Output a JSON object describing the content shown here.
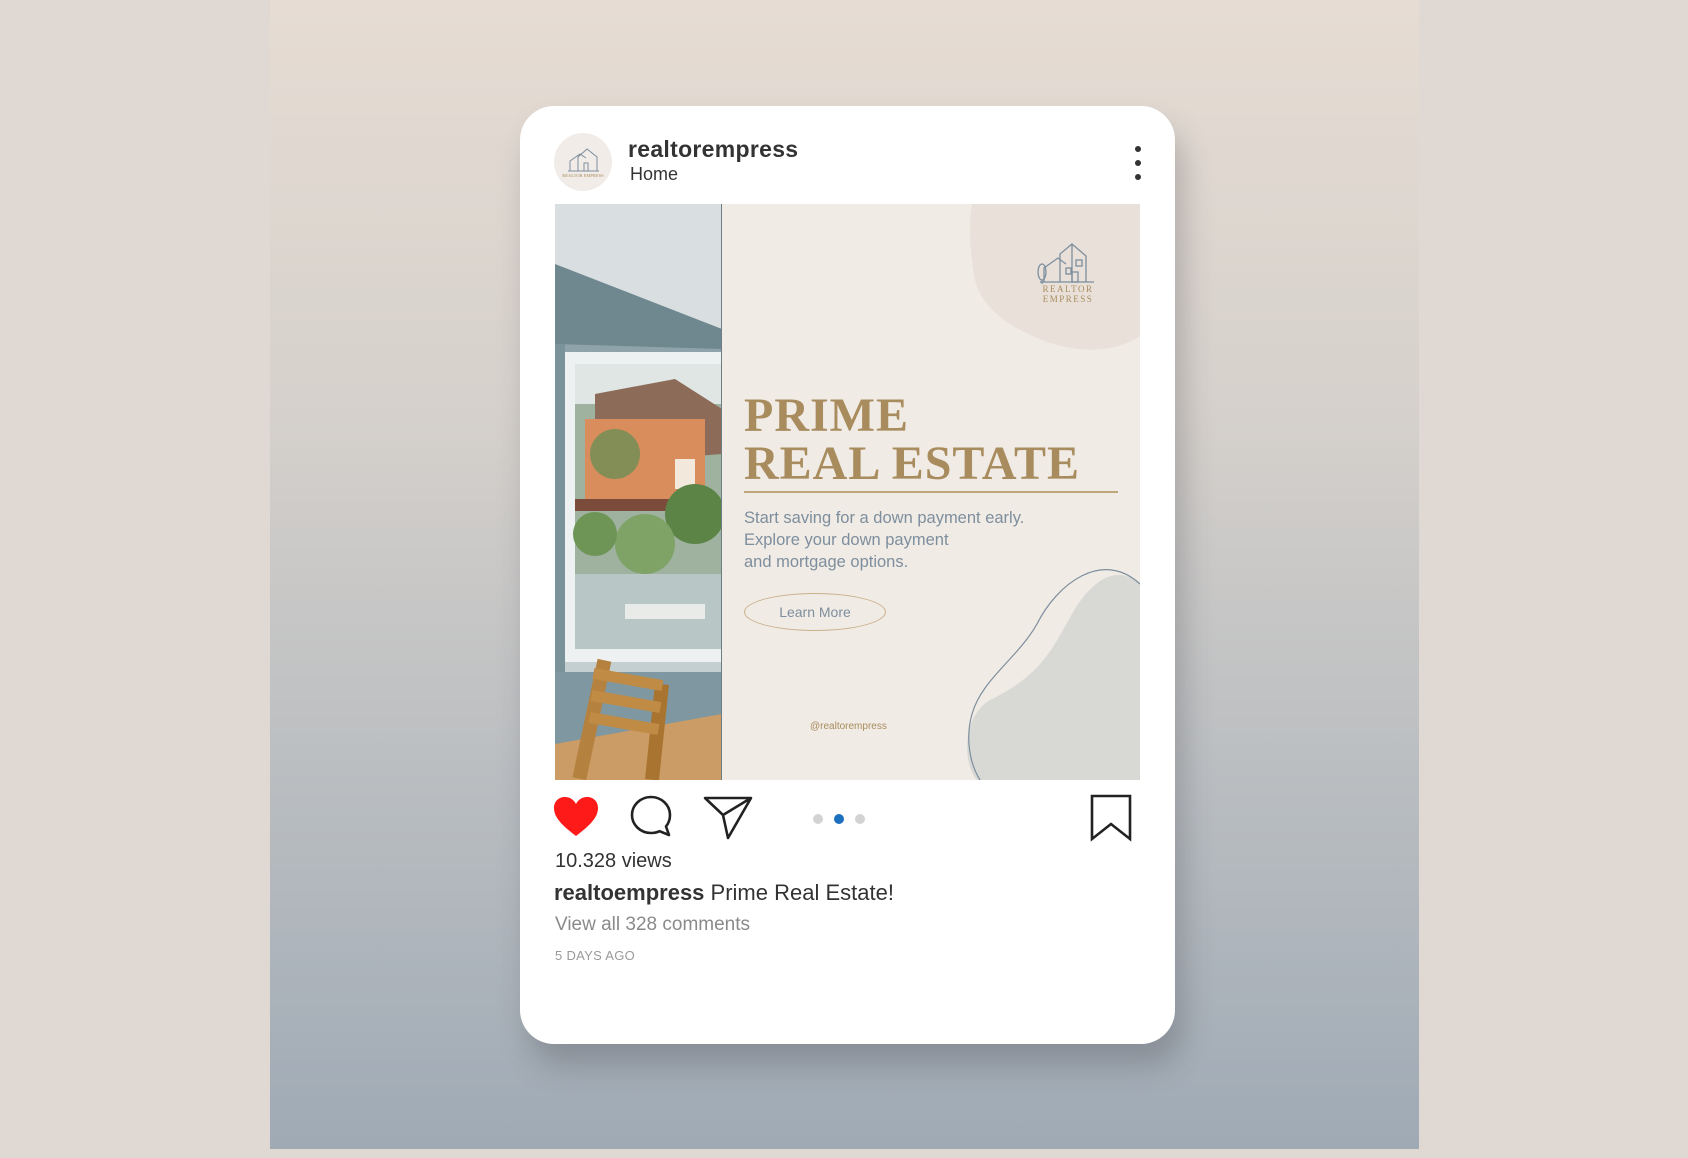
{
  "post": {
    "username": "realtorempress",
    "location": "Home",
    "avatar_logo": "REALTOR EMPRESS",
    "slide": {
      "logo_line1": "REALTOR",
      "logo_line2": "EMPRESS",
      "headline_line1": "PRIME",
      "headline_line2": "REAL ESTATE",
      "body_line1": "Start saving for a down payment early.",
      "body_line2": "Explore your down payment",
      "body_line3": "and mortgage options.",
      "button_label": "Learn More",
      "handle": "@realtorempress"
    },
    "carousel": {
      "count": 3,
      "active_index": 1
    },
    "views": "10.328 views",
    "caption_user": "realtoempress",
    "caption_text": "Prime Real Estate!",
    "comments_link": "View all 328 comments",
    "timestamp": "5 DAYS AGO",
    "liked": true
  },
  "icons": [
    "more-vertical-icon",
    "heart-icon",
    "comment-icon",
    "send-icon",
    "bookmark-icon",
    "house-logo-icon"
  ],
  "colors": {
    "heart": "#ff1a1a",
    "carousel_active": "#1d6fbf",
    "headline_gold": "#a88c5e",
    "slide_background": "#f1ebe5",
    "body_text_blue_gray": "#7d8e9e"
  }
}
